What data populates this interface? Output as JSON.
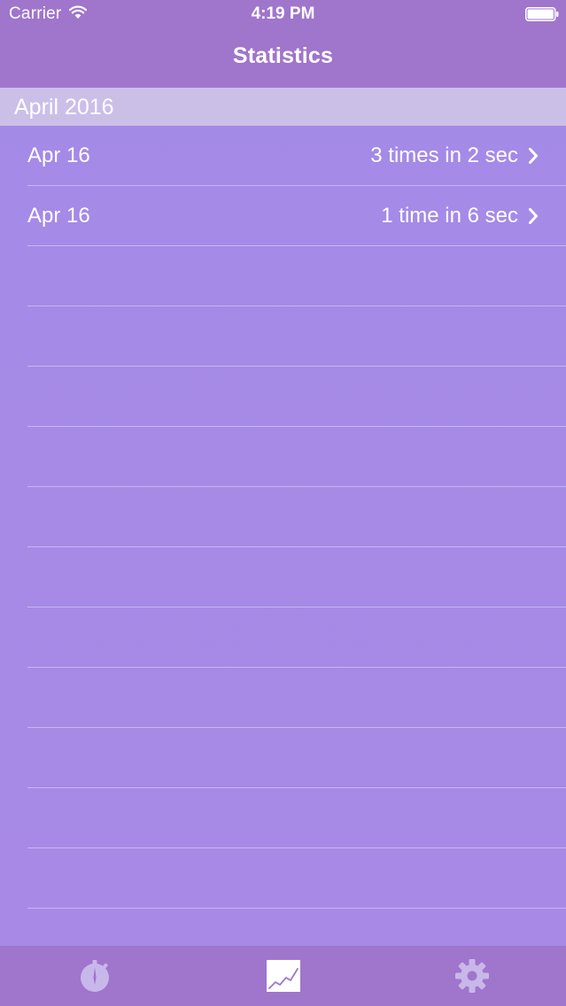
{
  "status_bar": {
    "carrier": "Carrier",
    "time": "4:19 PM"
  },
  "nav": {
    "title": "Statistics"
  },
  "section": {
    "header": "April 2016"
  },
  "rows": [
    {
      "date": "Apr 16",
      "detail": "3 times in 2 sec"
    },
    {
      "date": "Apr 16",
      "detail": "1 time in 6 sec"
    }
  ],
  "empty_row_count": 11,
  "tabs": [
    {
      "icon": "stopwatch-icon",
      "selected": false
    },
    {
      "icon": "chart-icon",
      "selected": true
    },
    {
      "icon": "gear-icon",
      "selected": false
    }
  ],
  "colors": {
    "background": "#a48ae7",
    "bars": "#a075cc",
    "section_header": "#cbbfe8",
    "inactive_tab_icon": "#c8b8ea"
  }
}
